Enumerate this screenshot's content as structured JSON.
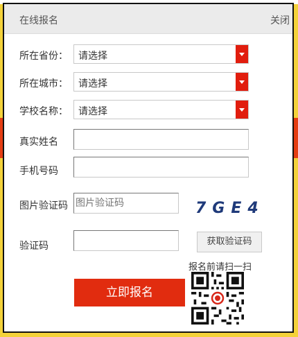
{
  "dialog": {
    "title": "在线报名",
    "close_label": "关闭"
  },
  "form": {
    "province_label": "所在省份：",
    "province_value": "请选择",
    "city_label": "所在城市：",
    "city_value": "请选择",
    "school_label": "学校名称：",
    "school_value": "请选择",
    "name_label": "真实姓名",
    "name_value": "",
    "phone_label": "手机号码",
    "phone_value": "",
    "image_code_label": "图片验证码",
    "image_code_placeholder": "图片验证码",
    "captcha_text": "7GE4",
    "sms_code_label": "验证码",
    "sms_code_value": "",
    "sms_button_label": "获取验证码",
    "submit_label": "立即报名",
    "qr_label": "报名前请扫一扫"
  },
  "colors": {
    "accent_red": "#e12c0f",
    "background_yellow": "#f4d23a"
  }
}
